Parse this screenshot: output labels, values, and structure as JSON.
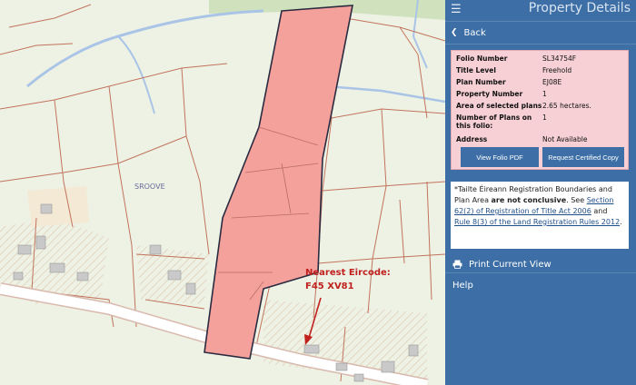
{
  "map": {
    "townland_label": "SROOVE",
    "annotation": {
      "line1": "Nearest Eircode:",
      "line2": "F45 XV81",
      "color": "#c0201e"
    },
    "parcel_fill": "#f4a19c",
    "parcel_outline": "#2b2b40",
    "boundary_color": "#c2735d",
    "road_color": "#ffffff",
    "stream_color": "#a9c4e6",
    "land_color": "#eef2e4",
    "building_color": "#c9c9c9"
  },
  "panel": {
    "menu_icon": "hamburger-icon",
    "title": "Property Details",
    "back_label": "Back",
    "details": [
      {
        "label": "Folio Number",
        "value": "SL34754F"
      },
      {
        "label": "Title Level",
        "value": "Freehold"
      },
      {
        "label": "Plan Number",
        "value": "EJ08E"
      },
      {
        "label": "Property Number",
        "value": "1"
      },
      {
        "label": "Area of selected plans",
        "value": "2.65 hectares."
      },
      {
        "label": "Number of Plans on this folio:",
        "value": "1"
      },
      {
        "label": "Address",
        "value": "Not Available"
      }
    ],
    "buttons": {
      "view_pdf": "View Folio PDF",
      "request_copy": "Request Certified Copy"
    },
    "note": {
      "intro": "*Tailte Éireann Registration Boundaries and Plan Area ",
      "bold": "are not conclusive",
      "mid": ". See ",
      "link1": "Section 62(2) of Registration of Title Act 2006",
      "and": " and ",
      "link2": "Rule 8(3) of the Land Registration Rules 2012",
      "end": "."
    },
    "print_label": "Print Current View",
    "help_label": "Help",
    "accent": "#3d6fa6",
    "details_bg": "#f6d0d4"
  }
}
